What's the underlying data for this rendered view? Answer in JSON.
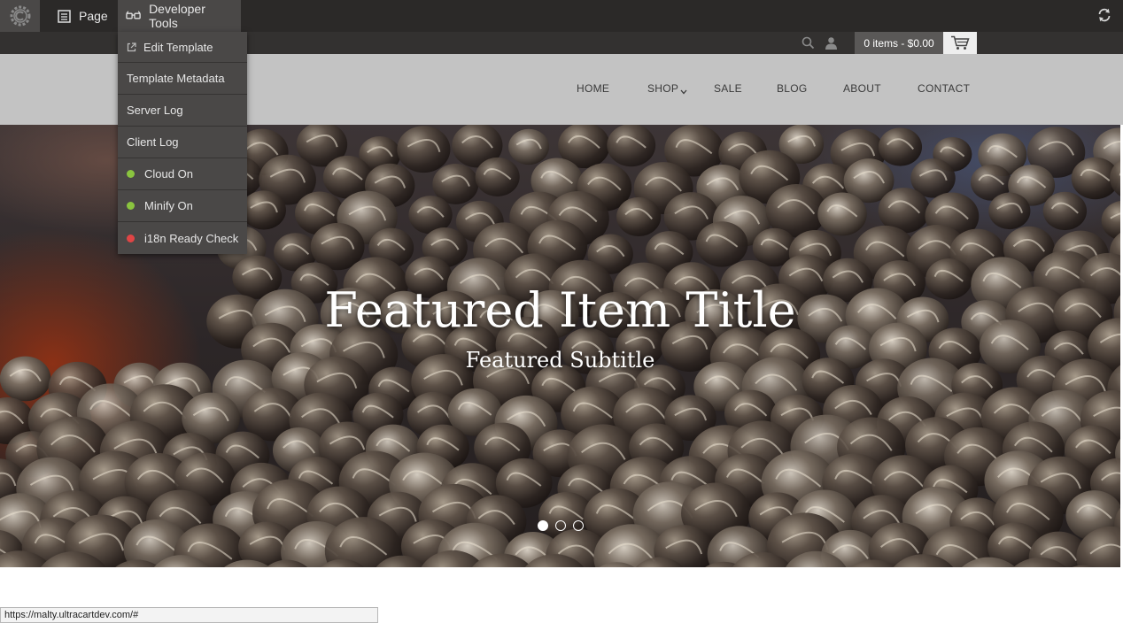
{
  "devbar": {
    "logo_icon": "c-gear-logo-icon",
    "page_label": "Page",
    "page_icon": "page-icon",
    "devtools_label": "Developer Tools",
    "devtools_icon": "glasses-icon",
    "refresh_icon": "refresh-icon"
  },
  "dropdown": {
    "items": [
      {
        "label": "Edit Template",
        "icon": "external-link-icon"
      },
      {
        "label": "Template Metadata"
      },
      {
        "label": "Server Log"
      },
      {
        "label": "Client Log"
      },
      {
        "label": "Cloud On",
        "status_color": "#8ac43f"
      },
      {
        "label": "Minify On",
        "status_color": "#8ac43f"
      },
      {
        "label": "i18n Ready Check",
        "status_color": "#e04545"
      }
    ]
  },
  "utilbar": {
    "cart_summary": "0 items - $0.00",
    "search_icon": "search-icon",
    "user_icon": "user-icon",
    "cart_icon": "cart-icon"
  },
  "nav": {
    "items": [
      "HOME",
      "SHOP",
      "SALE",
      "BLOG",
      "ABOUT",
      "CONTACT"
    ]
  },
  "hero": {
    "title": "Featured Item Title",
    "subtitle": "Featured Subtitle",
    "slides": 3,
    "active_slide": 1
  },
  "status_url": "https://malty.ultracartdev.com/#"
}
